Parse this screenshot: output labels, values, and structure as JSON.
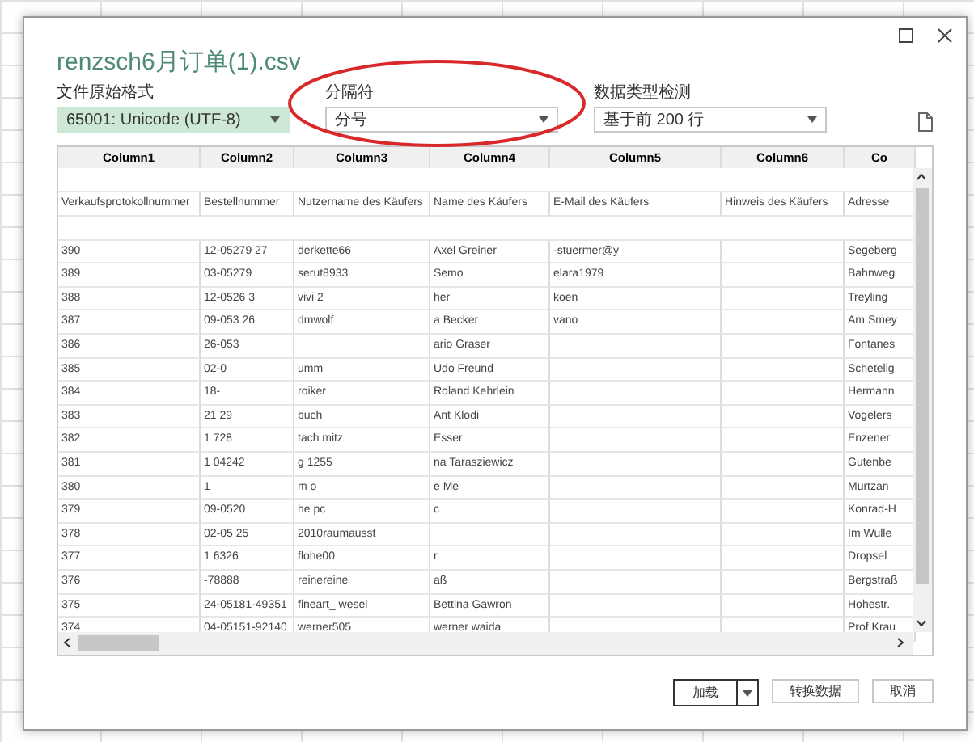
{
  "window": {
    "title": "renzsch6月订单(1).csv"
  },
  "options": [
    {
      "label": "文件原始格式",
      "value": "65001: Unicode (UTF-8)",
      "selected": true
    },
    {
      "label": "分隔符",
      "value": "分号",
      "selected": false
    },
    {
      "label": "数据类型检测",
      "value": "基于前 200 行",
      "selected": false
    }
  ],
  "table": {
    "columns": [
      "Column1",
      "Column2",
      "Column3",
      "Column4",
      "Column5",
      "Column6",
      "Co"
    ],
    "rows": [
      {
        "kind": "blank"
      },
      {
        "kind": "data",
        "cells": [
          "Verkaufsprotokollnummer",
          "Bestellnummer",
          "Nutzername des Käufers",
          "Name des Käufers",
          "E-Mail des Käufers",
          "Hinweis des Käufers",
          "Adresse"
        ]
      },
      {
        "kind": "blank"
      },
      {
        "kind": "data",
        "cells": [
          "390",
          "12-05279   27",
          "derkette66",
          "Axel Greiner",
          "-stuermer@y",
          null,
          "Segeberg"
        ]
      },
      {
        "kind": "data",
        "cells": [
          "389",
          "03-05279",
          "serut8933",
          "Semo",
          "elara1979",
          null,
          "Bahnweg"
        ]
      },
      {
        "kind": "data",
        "cells": [
          "388",
          "12-0526    3",
          "vivi    2",
          "her",
          "koen",
          null,
          "Treyling"
        ]
      },
      {
        "kind": "data",
        "cells": [
          "387",
          "09-053    26",
          "dmwolf",
          "a Becker",
          "vano",
          null,
          "Am Smey"
        ]
      },
      {
        "kind": "data",
        "cells": [
          "386",
          "26-053",
          null,
          "ario Graser",
          null,
          null,
          "Fontanes"
        ]
      },
      {
        "kind": "data",
        "cells": [
          "385",
          "02-0",
          "umm",
          "Udo Freund",
          null,
          null,
          "Schetelig"
        ]
      },
      {
        "kind": "data",
        "cells": [
          "384",
          "18-",
          "roiker",
          "Roland Kehrlein",
          null,
          null,
          "Hermann"
        ]
      },
      {
        "kind": "data",
        "cells": [
          "383",
          "21    29",
          "buch",
          "Ant Klodi",
          null,
          null,
          "Vogelers"
        ]
      },
      {
        "kind": "data",
        "cells": [
          "382",
          "1    728",
          "tach    mitz",
          "Esser",
          null,
          null,
          "Enzener"
        ]
      },
      {
        "kind": "data",
        "cells": [
          "381",
          "1    04242",
          "g    1255",
          "na Tarasziewicz",
          null,
          null,
          "Gutenbe"
        ]
      },
      {
        "kind": "data",
        "cells": [
          "380",
          "1",
          "m    o",
          "e Me",
          null,
          null,
          "Murtzan"
        ]
      },
      {
        "kind": "data",
        "cells": [
          "379",
          "09-0520",
          "he    pc",
          "c",
          null,
          null,
          "Konrad-H"
        ]
      },
      {
        "kind": "data",
        "cells": [
          "378",
          "02-05    25",
          "2010raumausst",
          null,
          null,
          null,
          "Im Wulle"
        ]
      },
      {
        "kind": "data",
        "cells": [
          "377",
          "1    6326",
          "flohe00",
          "r",
          null,
          null,
          "Dropsel"
        ]
      },
      {
        "kind": "data",
        "cells": [
          "376",
          "-78888",
          "reinereine",
          "aß",
          null,
          null,
          "Bergstraß"
        ]
      },
      {
        "kind": "data",
        "cells": [
          "375",
          "24-05181-49351",
          "fineart_    wesel",
          "Bettina Gawron",
          null,
          null,
          "Hohestr."
        ]
      },
      {
        "kind": "data",
        "cells": [
          "374",
          "04-05151-92140",
          "werner505",
          "werner waida",
          null,
          null,
          "Prof.Krau"
        ]
      }
    ]
  },
  "buttons": [
    {
      "label": "加载",
      "kind": "split"
    },
    {
      "label": "转换数据",
      "kind": "plain"
    },
    {
      "label": "取消",
      "kind": "plain"
    }
  ]
}
